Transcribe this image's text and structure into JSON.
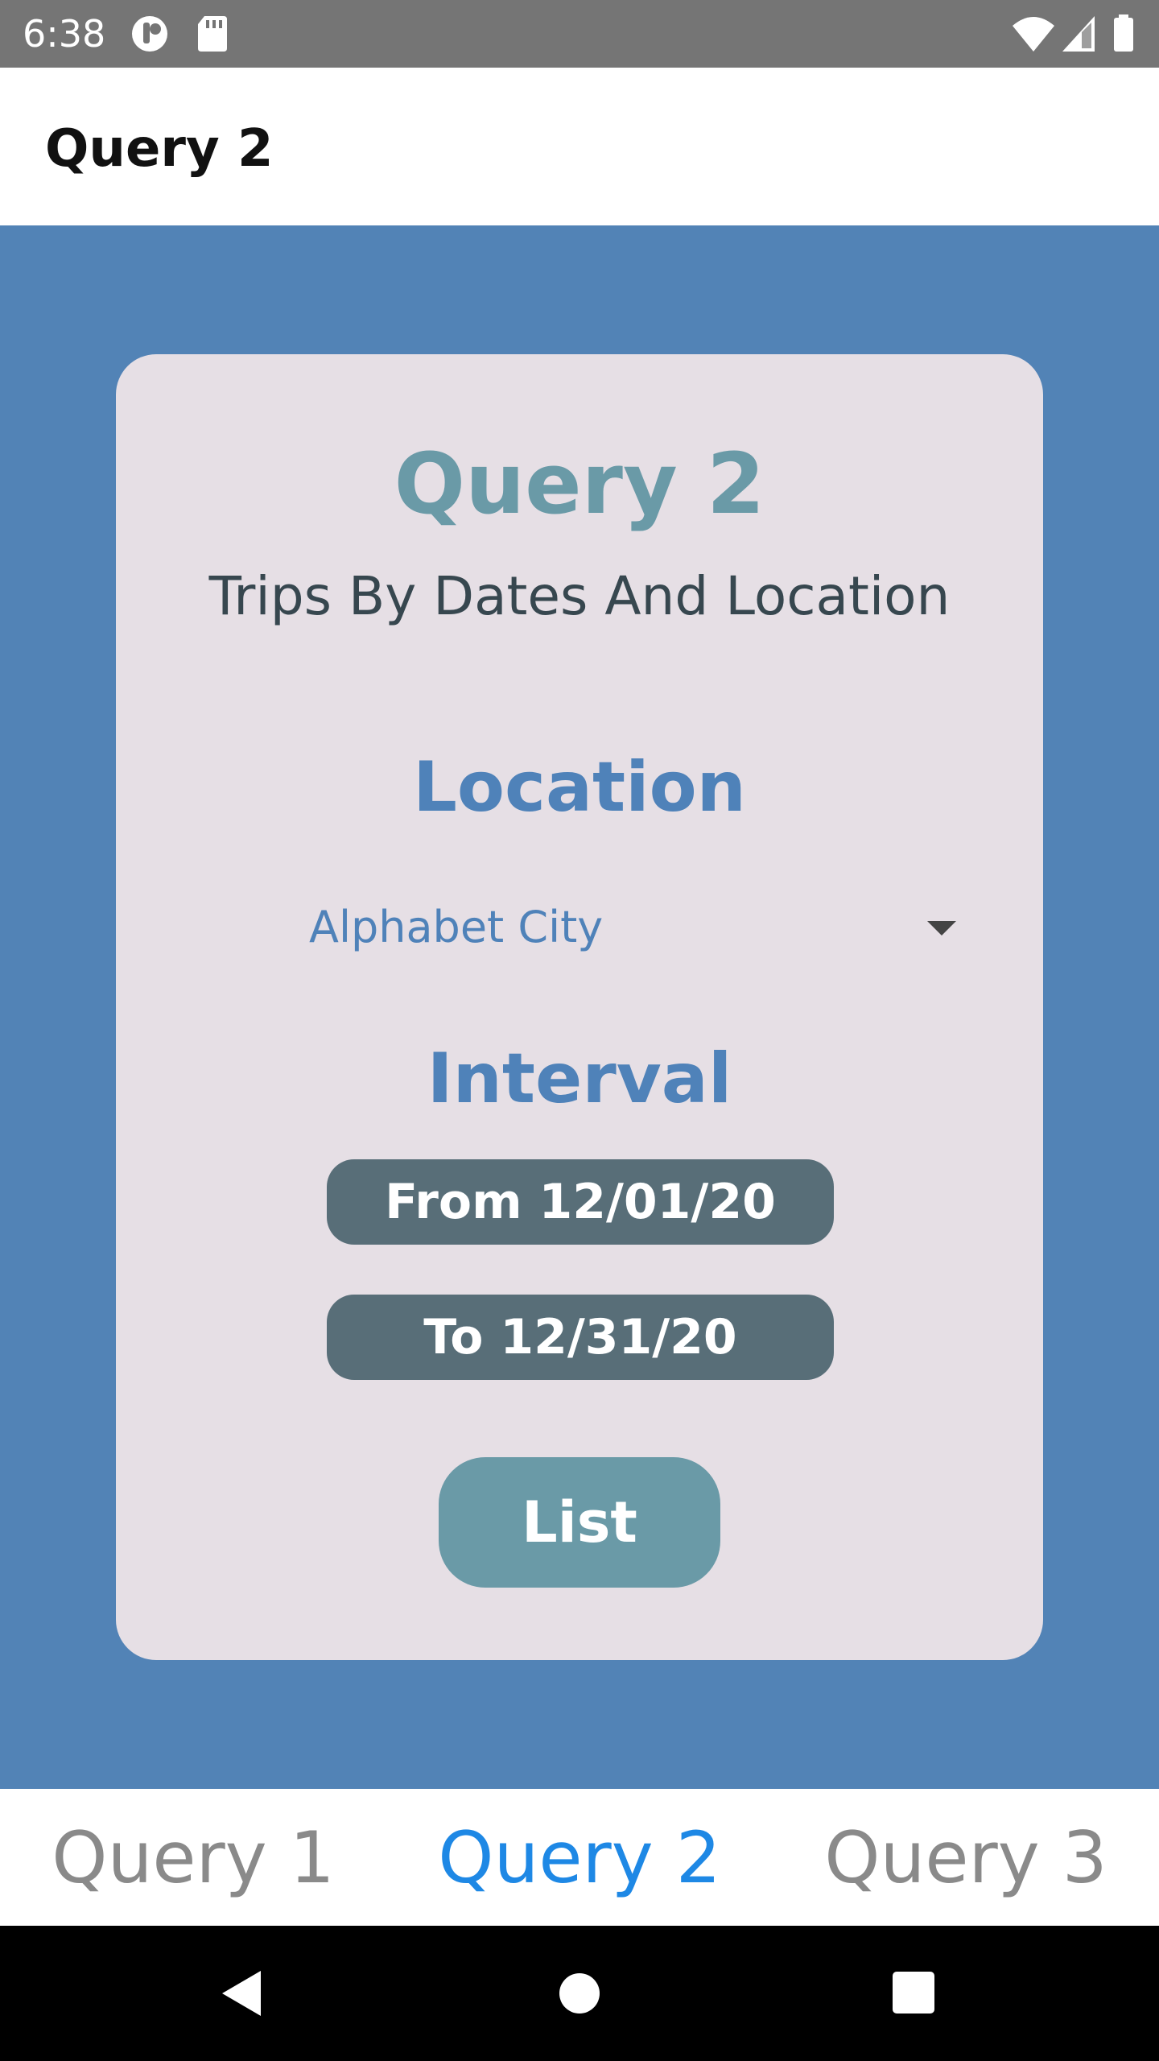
{
  "status_bar": {
    "time": "6:38",
    "icons": [
      "notification-icon",
      "sd-card-icon",
      "wifi-icon",
      "cell-signal-icon",
      "battery-icon"
    ]
  },
  "app_bar": {
    "title": "Query 2"
  },
  "card": {
    "title": "Query 2",
    "subtitle": "Trips By Dates And Location",
    "location_heading": "Location",
    "location_value": "Alphabet City",
    "interval_heading": "Interval",
    "from_label": "From 12/01/20",
    "to_label": "To 12/31/20",
    "list_label": "List"
  },
  "tabs": [
    {
      "label": "Query 1",
      "active": false
    },
    {
      "label": "Query 2",
      "active": true
    },
    {
      "label": "Query 3",
      "active": false
    }
  ],
  "nav": {
    "icons": [
      "back-icon",
      "home-icon",
      "recents-icon"
    ]
  },
  "colors": {
    "status_bar": "#757575",
    "background": "#5283b6",
    "card": "#e6dfe5",
    "accent_blue": "#4f82b9",
    "title_teal": "#6a9aa7",
    "date_button": "#586e78",
    "active_tab": "#1e88e5",
    "inactive_tab": "#8a8a8a"
  }
}
